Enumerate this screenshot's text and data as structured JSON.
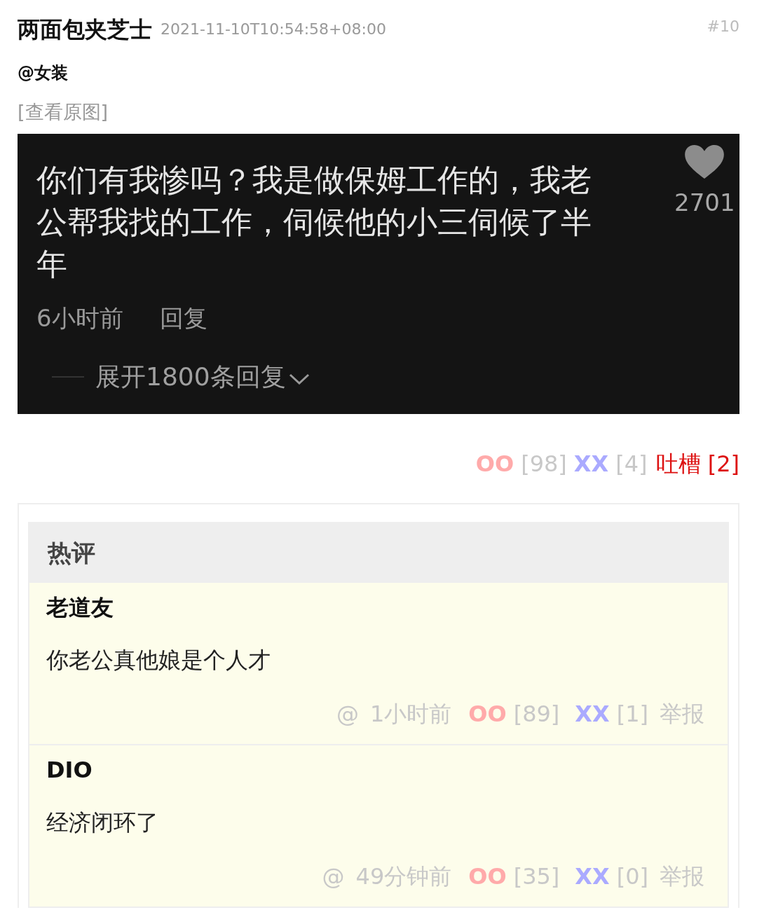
{
  "post": {
    "author": "两面包夹芝士",
    "time": "2021-11-10T10:54:58+08:00",
    "floor": "#10",
    "mention": "@女装",
    "view_original": "[查看原图]"
  },
  "embedded_screenshot": {
    "comment": "你们有我惨吗？我是做保姆工作的，我老公帮我找的工作，伺候他的小三伺候了半年",
    "likes": "2701",
    "time": "6小时前",
    "reply": "回复",
    "expand": "展开1800条回复"
  },
  "votes": {
    "oo_label": "OO",
    "oo_count": "[98]",
    "xx_label": "XX",
    "xx_count": "[4]",
    "tucao": "吐槽 [2]"
  },
  "hot_comments": {
    "title": "热评",
    "items": [
      {
        "author": "老道友",
        "text": "你老公真他娘是个人才",
        "reply": "@",
        "time": "1小时前",
        "oo_label": "OO",
        "oo_count": "[89]",
        "xx_label": "XX",
        "xx_count": "[1]",
        "report": "举报"
      },
      {
        "author": "DIO",
        "text": "经济闭环了",
        "reply": "@",
        "time": "49分钟前",
        "oo_label": "OO",
        "oo_count": "[35]",
        "xx_label": "XX",
        "xx_count": "[0]",
        "report": "举报"
      }
    ]
  }
}
